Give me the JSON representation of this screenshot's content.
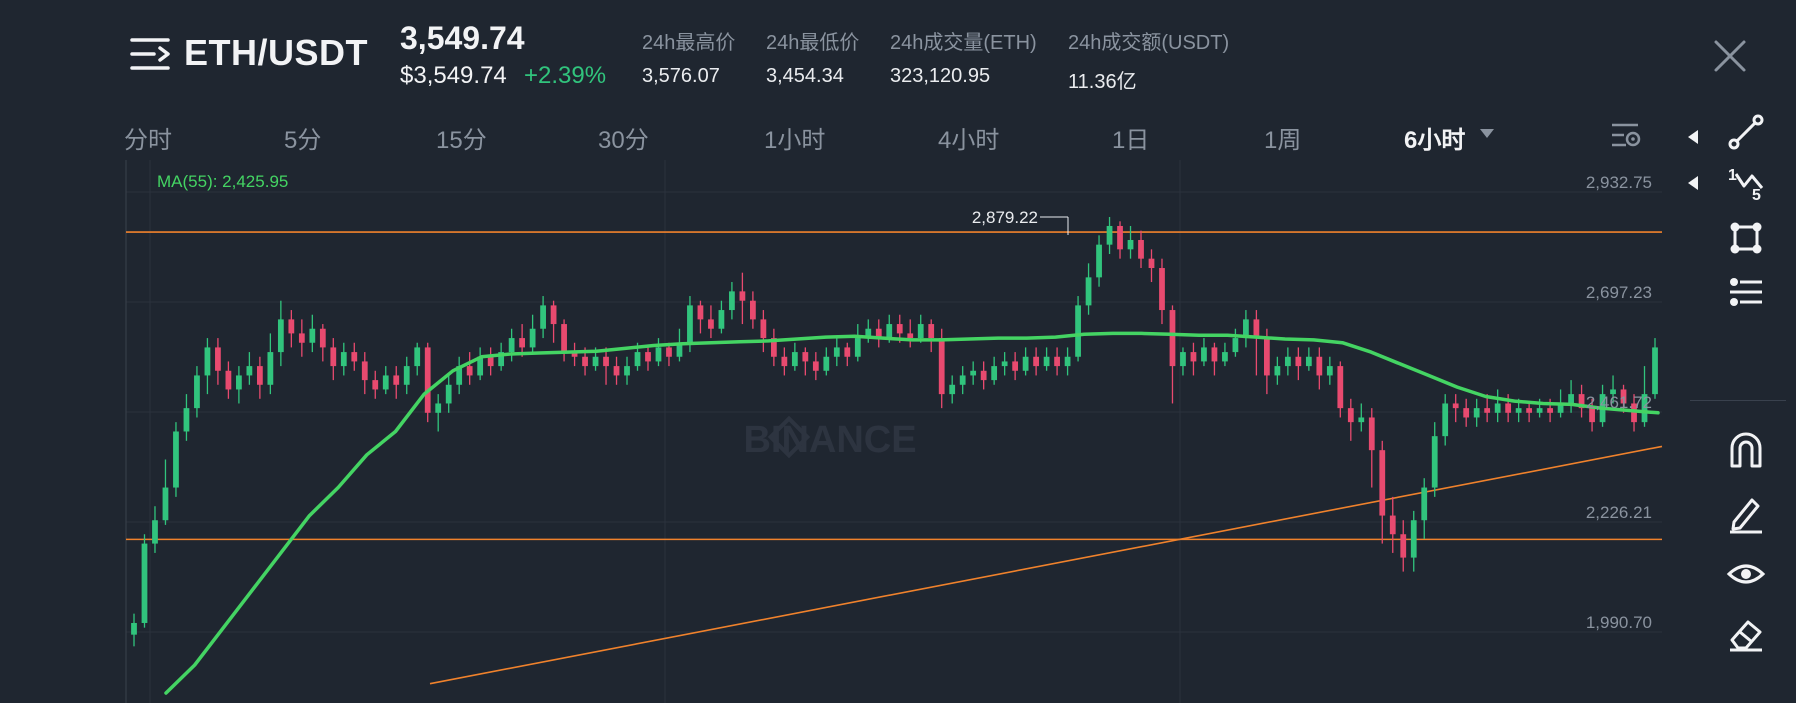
{
  "header": {
    "pair": "ETH/USDT",
    "price": "3,549.74",
    "price_usd": "$3,549.74",
    "change": "+2.39%",
    "stats": [
      {
        "label": "24h最高价",
        "value": "3,576.07"
      },
      {
        "label": "24h最低价",
        "value": "3,454.34"
      },
      {
        "label": "24h成交量(ETH)",
        "value": "323,120.95"
      },
      {
        "label": "24h成交额(USDT)",
        "value": "11.36亿"
      }
    ]
  },
  "tabs": [
    {
      "label": "分时"
    },
    {
      "label": "5分"
    },
    {
      "label": "15分"
    },
    {
      "label": "30分"
    },
    {
      "label": "1小时"
    },
    {
      "label": "4小时"
    },
    {
      "label": "1日"
    },
    {
      "label": "1周"
    },
    {
      "label": "6小时"
    }
  ],
  "active_tab": "6小时",
  "toolbar": {
    "tools": [
      "line-tool-icon",
      "fib-tool-icon",
      "shape-tool-icon",
      "indicator-tool-icon",
      "magnet-icon",
      "pencil-icon",
      "eye-icon",
      "eraser-icon"
    ]
  },
  "chart_data": {
    "type": "candlestick",
    "watermark": "BINANCE",
    "ma_label": "MA(55): 2,425.95",
    "y_ticks": [
      "2,932.75",
      "2,697.23",
      "2,461.72",
      "2,226.21",
      "1,990.70"
    ],
    "y_tick_values": [
      2932.75,
      2697.23,
      2461.72,
      2226.21,
      1990.7
    ],
    "high_label": "2,879.22",
    "high_value": 2879.22,
    "horizontal_lines": [
      2847,
      2189
    ],
    "trend_line": {
      "start": 1880,
      "end": 2388
    },
    "ma_series": [
      1860,
      1920,
      2000,
      2080,
      2160,
      2240,
      2300,
      2370,
      2420,
      2500,
      2550,
      2580,
      2586,
      2588,
      2590,
      2592,
      2598,
      2604,
      2608,
      2610,
      2612,
      2614,
      2618,
      2622,
      2624,
      2620,
      2616,
      2616,
      2618,
      2620,
      2620,
      2622,
      2628,
      2630,
      2630,
      2628,
      2626,
      2626,
      2622,
      2618,
      2616,
      2610,
      2590,
      2565,
      2540,
      2515,
      2495,
      2485,
      2480,
      2478,
      2470,
      2465,
      2460
    ],
    "candles": [
      [
        1985,
        2010,
        1960,
        2030
      ],
      [
        2010,
        2180,
        2000,
        2200
      ],
      [
        2180,
        2230,
        2160,
        2260
      ],
      [
        2230,
        2300,
        2220,
        2360
      ],
      [
        2300,
        2420,
        2280,
        2440
      ],
      [
        2420,
        2470,
        2400,
        2500
      ],
      [
        2470,
        2540,
        2450,
        2560
      ],
      [
        2540,
        2600,
        2500,
        2620
      ],
      [
        2600,
        2550,
        2520,
        2620
      ],
      [
        2550,
        2510,
        2490,
        2570
      ],
      [
        2510,
        2540,
        2480,
        2560
      ],
      [
        2540,
        2560,
        2520,
        2590
      ],
      [
        2560,
        2520,
        2490,
        2580
      ],
      [
        2520,
        2590,
        2500,
        2630
      ],
      [
        2590,
        2660,
        2560,
        2700
      ],
      [
        2660,
        2630,
        2600,
        2680
      ],
      [
        2630,
        2610,
        2580,
        2660
      ],
      [
        2610,
        2640,
        2590,
        2670
      ],
      [
        2640,
        2600,
        2570,
        2650
      ],
      [
        2600,
        2560,
        2530,
        2620
      ],
      [
        2560,
        2590,
        2540,
        2610
      ],
      [
        2590,
        2570,
        2550,
        2610
      ],
      [
        2570,
        2530,
        2500,
        2590
      ],
      [
        2530,
        2510,
        2490,
        2550
      ],
      [
        2510,
        2540,
        2500,
        2560
      ],
      [
        2540,
        2520,
        2490,
        2560
      ],
      [
        2520,
        2560,
        2500,
        2580
      ],
      [
        2560,
        2600,
        2540,
        2610
      ],
      [
        2600,
        2460,
        2440,
        2610
      ],
      [
        2460,
        2480,
        2420,
        2500
      ],
      [
        2480,
        2520,
        2460,
        2540
      ],
      [
        2520,
        2560,
        2500,
        2580
      ],
      [
        2560,
        2540,
        2520,
        2590
      ],
      [
        2540,
        2580,
        2530,
        2600
      ],
      [
        2580,
        2560,
        2540,
        2600
      ],
      [
        2560,
        2590,
        2550,
        2610
      ],
      [
        2590,
        2620,
        2570,
        2640
      ],
      [
        2620,
        2600,
        2580,
        2650
      ],
      [
        2600,
        2640,
        2590,
        2670
      ],
      [
        2640,
        2690,
        2620,
        2710
      ],
      [
        2690,
        2650,
        2610,
        2700
      ],
      [
        2650,
        2590,
        2570,
        2660
      ],
      [
        2590,
        2580,
        2560,
        2610
      ],
      [
        2580,
        2560,
        2540,
        2600
      ],
      [
        2560,
        2580,
        2550,
        2600
      ],
      [
        2580,
        2560,
        2520,
        2600
      ],
      [
        2560,
        2540,
        2520,
        2580
      ],
      [
        2540,
        2560,
        2520,
        2580
      ],
      [
        2560,
        2590,
        2550,
        2610
      ],
      [
        2590,
        2570,
        2550,
        2600
      ],
      [
        2570,
        2600,
        2560,
        2620
      ],
      [
        2600,
        2580,
        2560,
        2610
      ],
      [
        2580,
        2610,
        2570,
        2640
      ],
      [
        2610,
        2690,
        2590,
        2710
      ],
      [
        2690,
        2660,
        2630,
        2700
      ],
      [
        2660,
        2640,
        2620,
        2690
      ],
      [
        2640,
        2680,
        2630,
        2700
      ],
      [
        2680,
        2720,
        2660,
        2740
      ],
      [
        2720,
        2700,
        2650,
        2760
      ],
      [
        2700,
        2660,
        2640,
        2720
      ],
      [
        2660,
        2620,
        2590,
        2680
      ],
      [
        2620,
        2580,
        2560,
        2640
      ],
      [
        2580,
        2560,
        2540,
        2600
      ],
      [
        2560,
        2590,
        2550,
        2610
      ],
      [
        2590,
        2570,
        2540,
        2600
      ],
      [
        2570,
        2550,
        2530,
        2590
      ],
      [
        2550,
        2580,
        2540,
        2600
      ],
      [
        2580,
        2600,
        2560,
        2620
      ],
      [
        2600,
        2580,
        2560,
        2610
      ],
      [
        2580,
        2620,
        2570,
        2650
      ],
      [
        2620,
        2640,
        2610,
        2660
      ],
      [
        2640,
        2620,
        2600,
        2660
      ],
      [
        2620,
        2650,
        2610,
        2670
      ],
      [
        2650,
        2630,
        2610,
        2670
      ],
      [
        2630,
        2620,
        2600,
        2660
      ],
      [
        2620,
        2650,
        2610,
        2670
      ],
      [
        2650,
        2620,
        2590,
        2660
      ],
      [
        2620,
        2500,
        2470,
        2640
      ],
      [
        2500,
        2520,
        2480,
        2540
      ],
      [
        2520,
        2540,
        2500,
        2560
      ],
      [
        2540,
        2550,
        2520,
        2570
      ],
      [
        2550,
        2530,
        2510,
        2570
      ],
      [
        2530,
        2560,
        2520,
        2580
      ],
      [
        2560,
        2570,
        2540,
        2590
      ],
      [
        2570,
        2550,
        2530,
        2590
      ],
      [
        2550,
        2580,
        2540,
        2600
      ],
      [
        2580,
        2560,
        2540,
        2600
      ],
      [
        2560,
        2580,
        2550,
        2600
      ],
      [
        2580,
        2560,
        2540,
        2600
      ],
      [
        2560,
        2580,
        2540,
        2600
      ],
      [
        2580,
        2690,
        2570,
        2710
      ],
      [
        2690,
        2750,
        2670,
        2780
      ],
      [
        2750,
        2820,
        2730,
        2840
      ],
      [
        2820,
        2860,
        2800,
        2879.22
      ],
      [
        2860,
        2810,
        2790,
        2870
      ],
      [
        2810,
        2830,
        2790,
        2860
      ],
      [
        2830,
        2790,
        2770,
        2850
      ],
      [
        2790,
        2770,
        2740,
        2810
      ],
      [
        2770,
        2680,
        2650,
        2790
      ],
      [
        2680,
        2560,
        2480,
        2690
      ],
      [
        2560,
        2590,
        2540,
        2600
      ],
      [
        2590,
        2570,
        2540,
        2610
      ],
      [
        2570,
        2600,
        2560,
        2620
      ],
      [
        2600,
        2570,
        2540,
        2610
      ],
      [
        2570,
        2590,
        2560,
        2610
      ],
      [
        2590,
        2620,
        2580,
        2640
      ],
      [
        2620,
        2660,
        2600,
        2680
      ],
      [
        2660,
        2620,
        2540,
        2680
      ],
      [
        2620,
        2540,
        2500,
        2640
      ],
      [
        2540,
        2560,
        2520,
        2580
      ],
      [
        2560,
        2580,
        2540,
        2600
      ],
      [
        2580,
        2560,
        2530,
        2600
      ],
      [
        2560,
        2580,
        2550,
        2600
      ],
      [
        2580,
        2540,
        2510,
        2600
      ],
      [
        2540,
        2560,
        2520,
        2580
      ],
      [
        2560,
        2470,
        2450,
        2570
      ],
      [
        2470,
        2440,
        2400,
        2490
      ],
      [
        2440,
        2450,
        2420,
        2480
      ],
      [
        2450,
        2380,
        2300,
        2470
      ],
      [
        2380,
        2240,
        2180,
        2400
      ],
      [
        2240,
        2200,
        2160,
        2280
      ],
      [
        2200,
        2150,
        2120,
        2230
      ],
      [
        2150,
        2230,
        2120,
        2250
      ],
      [
        2230,
        2300,
        2190,
        2320
      ],
      [
        2300,
        2410,
        2280,
        2440
      ],
      [
        2410,
        2480,
        2390,
        2500
      ],
      [
        2480,
        2470,
        2440,
        2500
      ],
      [
        2470,
        2450,
        2430,
        2490
      ],
      [
        2450,
        2470,
        2430,
        2490
      ],
      [
        2470,
        2460,
        2440,
        2500
      ],
      [
        2460,
        2480,
        2440,
        2510
      ],
      [
        2480,
        2460,
        2440,
        2500
      ],
      [
        2460,
        2470,
        2440,
        2490
      ],
      [
        2470,
        2460,
        2440,
        2480
      ],
      [
        2460,
        2470,
        2450,
        2490
      ],
      [
        2470,
        2460,
        2440,
        2490
      ],
      [
        2460,
        2480,
        2450,
        2510
      ],
      [
        2480,
        2500,
        2460,
        2530
      ],
      [
        2500,
        2470,
        2450,
        2520
      ],
      [
        2470,
        2440,
        2420,
        2490
      ],
      [
        2440,
        2500,
        2430,
        2520
      ],
      [
        2500,
        2510,
        2480,
        2540
      ],
      [
        2510,
        2480,
        2460,
        2520
      ],
      [
        2480,
        2440,
        2420,
        2500
      ],
      [
        2440,
        2500,
        2430,
        2560
      ],
      [
        2500,
        2600,
        2490,
        2620
      ]
    ]
  }
}
